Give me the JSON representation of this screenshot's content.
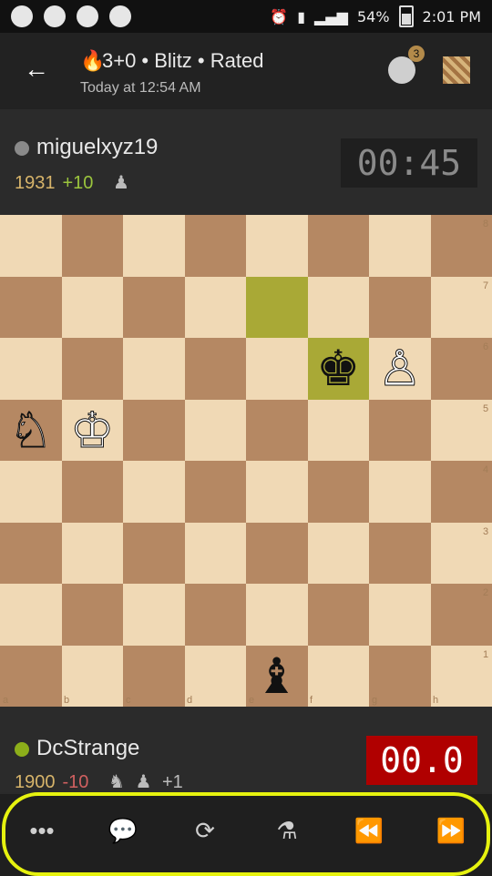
{
  "statusbar": {
    "time": "2:01 PM",
    "battery": "54%"
  },
  "header": {
    "title": "3+0 • Blitz • Rated",
    "subtitle": "Today at 12:54 AM",
    "badge": "3"
  },
  "top_player": {
    "name": "miguelxyz19",
    "rating": "1931",
    "delta": "+10",
    "clock": "00:45"
  },
  "bottom_player": {
    "name": "DcStrange",
    "rating": "1900",
    "delta": "-10",
    "material": "+1",
    "clock": "00.0"
  },
  "board": {
    "files": [
      "a",
      "b",
      "c",
      "d",
      "e",
      "f",
      "g",
      "h"
    ],
    "ranks": [
      "8",
      "7",
      "6",
      "5",
      "4",
      "3",
      "2",
      "1"
    ],
    "pieces": {
      "black_king": "♚",
      "white_pawn": "♙",
      "white_knight": "♘",
      "white_king": "♔",
      "black_bishop": "♝"
    }
  },
  "toolbar": {
    "menu": "•••",
    "chat": "💬",
    "flip": "⟳",
    "analysis": "⚗",
    "prev": "⏪",
    "next": "⏩"
  }
}
